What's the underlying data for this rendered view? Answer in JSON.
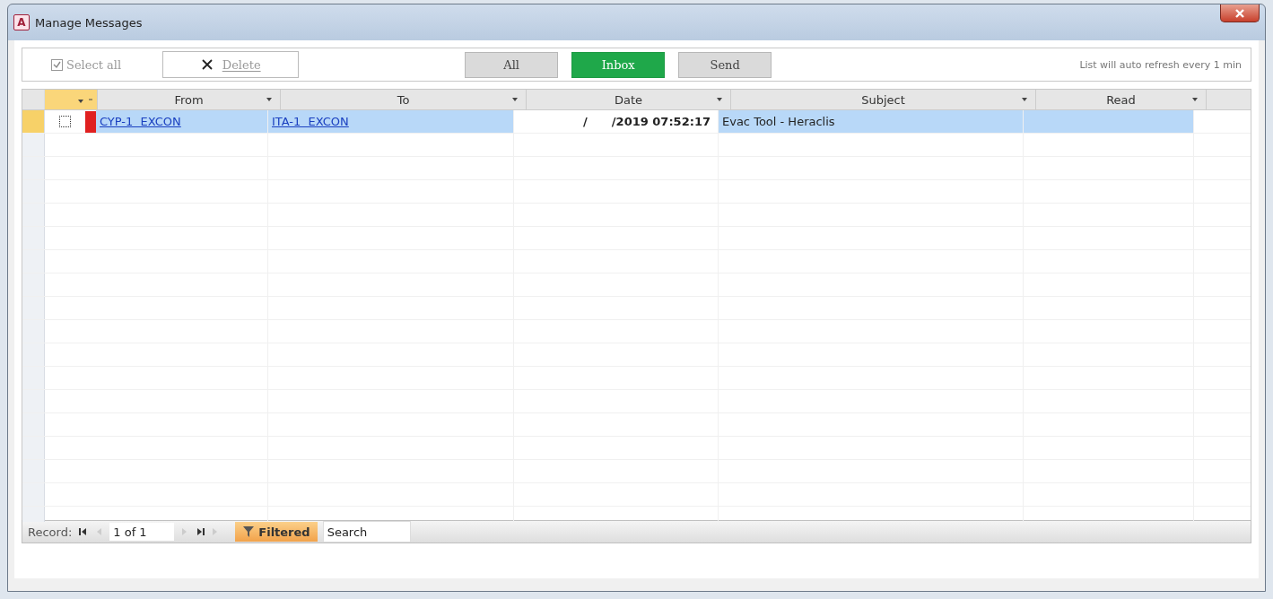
{
  "window": {
    "title": "Manage Messages",
    "app_icon": "A"
  },
  "toolbar": {
    "select_all": {
      "label": "Select all",
      "checked": true,
      "disabled": true
    },
    "delete": {
      "label": "Delete",
      "disabled": true
    },
    "filters": [
      {
        "label": "All",
        "selected": false
      },
      {
        "label": "Inbox",
        "selected": true
      },
      {
        "label": "Send",
        "selected": false
      }
    ],
    "note": "List will auto refresh every 1 min"
  },
  "table": {
    "columns": [
      "From",
      "To",
      "Date",
      "Subject",
      "Read"
    ],
    "rows": [
      {
        "checked": false,
        "selected": true,
        "color": "#e02020",
        "from": "CYP-1  EXCON",
        "to": "ITA-1  EXCON",
        "date": "/      /2019 07:52:17",
        "subject": "Evac Tool - Heraclis",
        "read": ""
      }
    ]
  },
  "navigation": {
    "label": "Record:",
    "position": "1 of 1",
    "filter": "Filtered",
    "search_placeholder": "Search"
  }
}
